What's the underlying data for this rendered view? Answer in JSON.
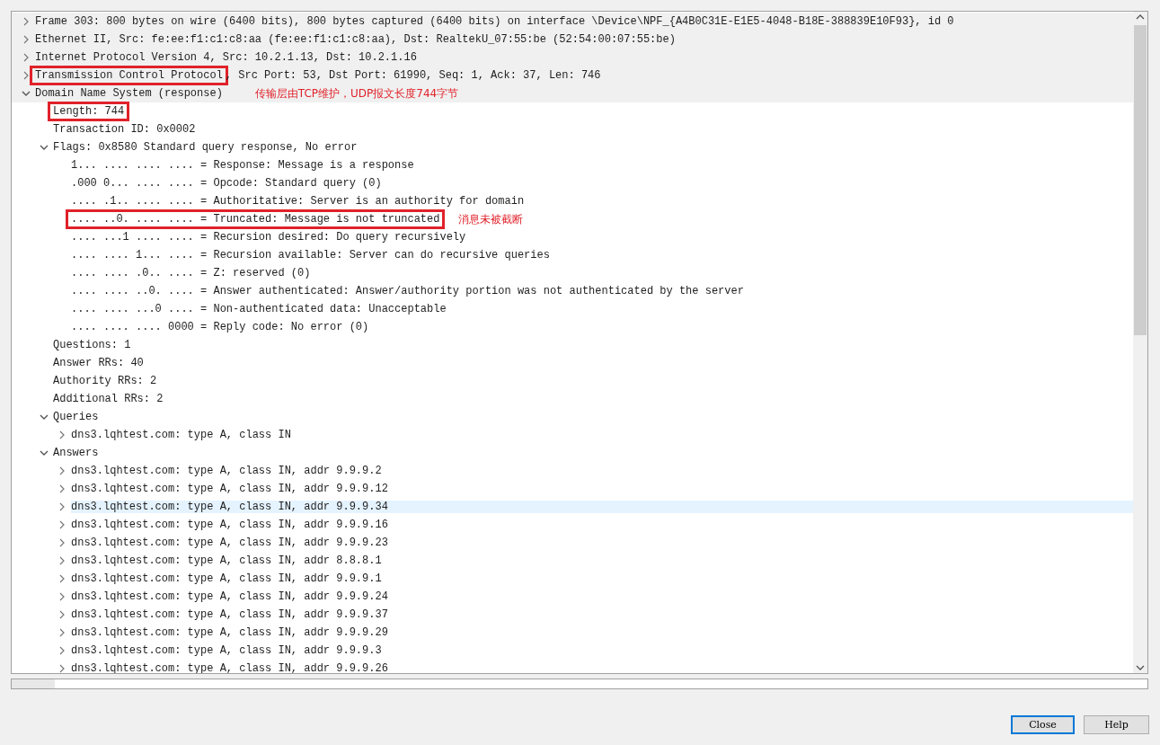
{
  "tree": [
    {
      "text": "Frame 303: 800 bytes on wire (6400 bits), 800 bytes captured (6400 bits) on interface \\Device\\NPF_{A4B0C31E-E1E5-4048-B18E-388839E10F93}, id 0",
      "expanded": false
    },
    {
      "text": "Ethernet II, Src: fe:ee:f1:c1:c8:aa (fe:ee:f1:c1:c8:aa), Dst: RealtekU_07:55:be (52:54:00:07:55:be)",
      "expanded": false
    },
    {
      "text": "Internet Protocol Version 4, Src: 10.2.1.13, Dst: 10.2.1.16",
      "expanded": false
    },
    {
      "boxed": "Transmission Control Protocol",
      "text": ", Src Port: 53, Dst Port: 61990, Seq: 1, Ack: 37, Len: 746",
      "expanded": false
    },
    {
      "text": "Domain Name System (response)",
      "expanded": true,
      "note": "传输层由TCP维护，UDP报文长度744字节",
      "children": [
        {
          "boxed": "Length: 744"
        },
        {
          "text": "Transaction ID: 0x0002"
        },
        {
          "text": "Flags: 0x8580 Standard query response, No error",
          "expanded": true,
          "children": [
            {
              "text": "1... .... .... .... = Response: Message is a response"
            },
            {
              "text": ".000 0... .... .... = Opcode: Standard query (0)"
            },
            {
              "text": ".... .1.. .... .... = Authoritative: Server is an authority for domain"
            },
            {
              "boxed": ".... ..0. .... .... = Truncated: Message is not truncated",
              "note": "消息未被截断"
            },
            {
              "text": ".... ...1 .... .... = Recursion desired: Do query recursively"
            },
            {
              "text": ".... .... 1... .... = Recursion available: Server can do recursive queries"
            },
            {
              "text": ".... .... .0.. .... = Z: reserved (0)"
            },
            {
              "text": ".... .... ..0. .... = Answer authenticated: Answer/authority portion was not authenticated by the server"
            },
            {
              "text": ".... .... ...0 .... = Non-authenticated data: Unacceptable"
            },
            {
              "text": ".... .... .... 0000 = Reply code: No error (0)"
            }
          ]
        },
        {
          "text": "Questions: 1"
        },
        {
          "text": "Answer RRs: 40"
        },
        {
          "text": "Authority RRs: 2"
        },
        {
          "text": "Additional RRs: 2"
        },
        {
          "text": "Queries",
          "expanded": true,
          "children": [
            {
              "text": "dns3.lqhtest.com: type A, class IN",
              "expanded": false
            }
          ]
        },
        {
          "text": "Answers",
          "expanded": true,
          "children": [
            {
              "text": "dns3.lqhtest.com: type A, class IN, addr 9.9.9.2",
              "expanded": false
            },
            {
              "text": "dns3.lqhtest.com: type A, class IN, addr 9.9.9.12",
              "expanded": false
            },
            {
              "text": "dns3.lqhtest.com: type A, class IN, addr 9.9.9.34",
              "expanded": false,
              "highlighted": true
            },
            {
              "text": "dns3.lqhtest.com: type A, class IN, addr 9.9.9.16",
              "expanded": false
            },
            {
              "text": "dns3.lqhtest.com: type A, class IN, addr 9.9.9.23",
              "expanded": false
            },
            {
              "text": "dns3.lqhtest.com: type A, class IN, addr 8.8.8.1",
              "expanded": false
            },
            {
              "text": "dns3.lqhtest.com: type A, class IN, addr 9.9.9.1",
              "expanded": false
            },
            {
              "text": "dns3.lqhtest.com: type A, class IN, addr 9.9.9.24",
              "expanded": false
            },
            {
              "text": "dns3.lqhtest.com: type A, class IN, addr 9.9.9.37",
              "expanded": false
            },
            {
              "text": "dns3.lqhtest.com: type A, class IN, addr 9.9.9.29",
              "expanded": false
            },
            {
              "text": "dns3.lqhtest.com: type A, class IN, addr 9.9.9.3",
              "expanded": false
            },
            {
              "text": "dns3.lqhtest.com: type A, class IN, addr 9.9.9.26",
              "expanded": false
            }
          ]
        }
      ]
    }
  ],
  "buttons": [
    {
      "label": "Close",
      "selected": true
    },
    {
      "label": "Help",
      "selected": false
    }
  ]
}
